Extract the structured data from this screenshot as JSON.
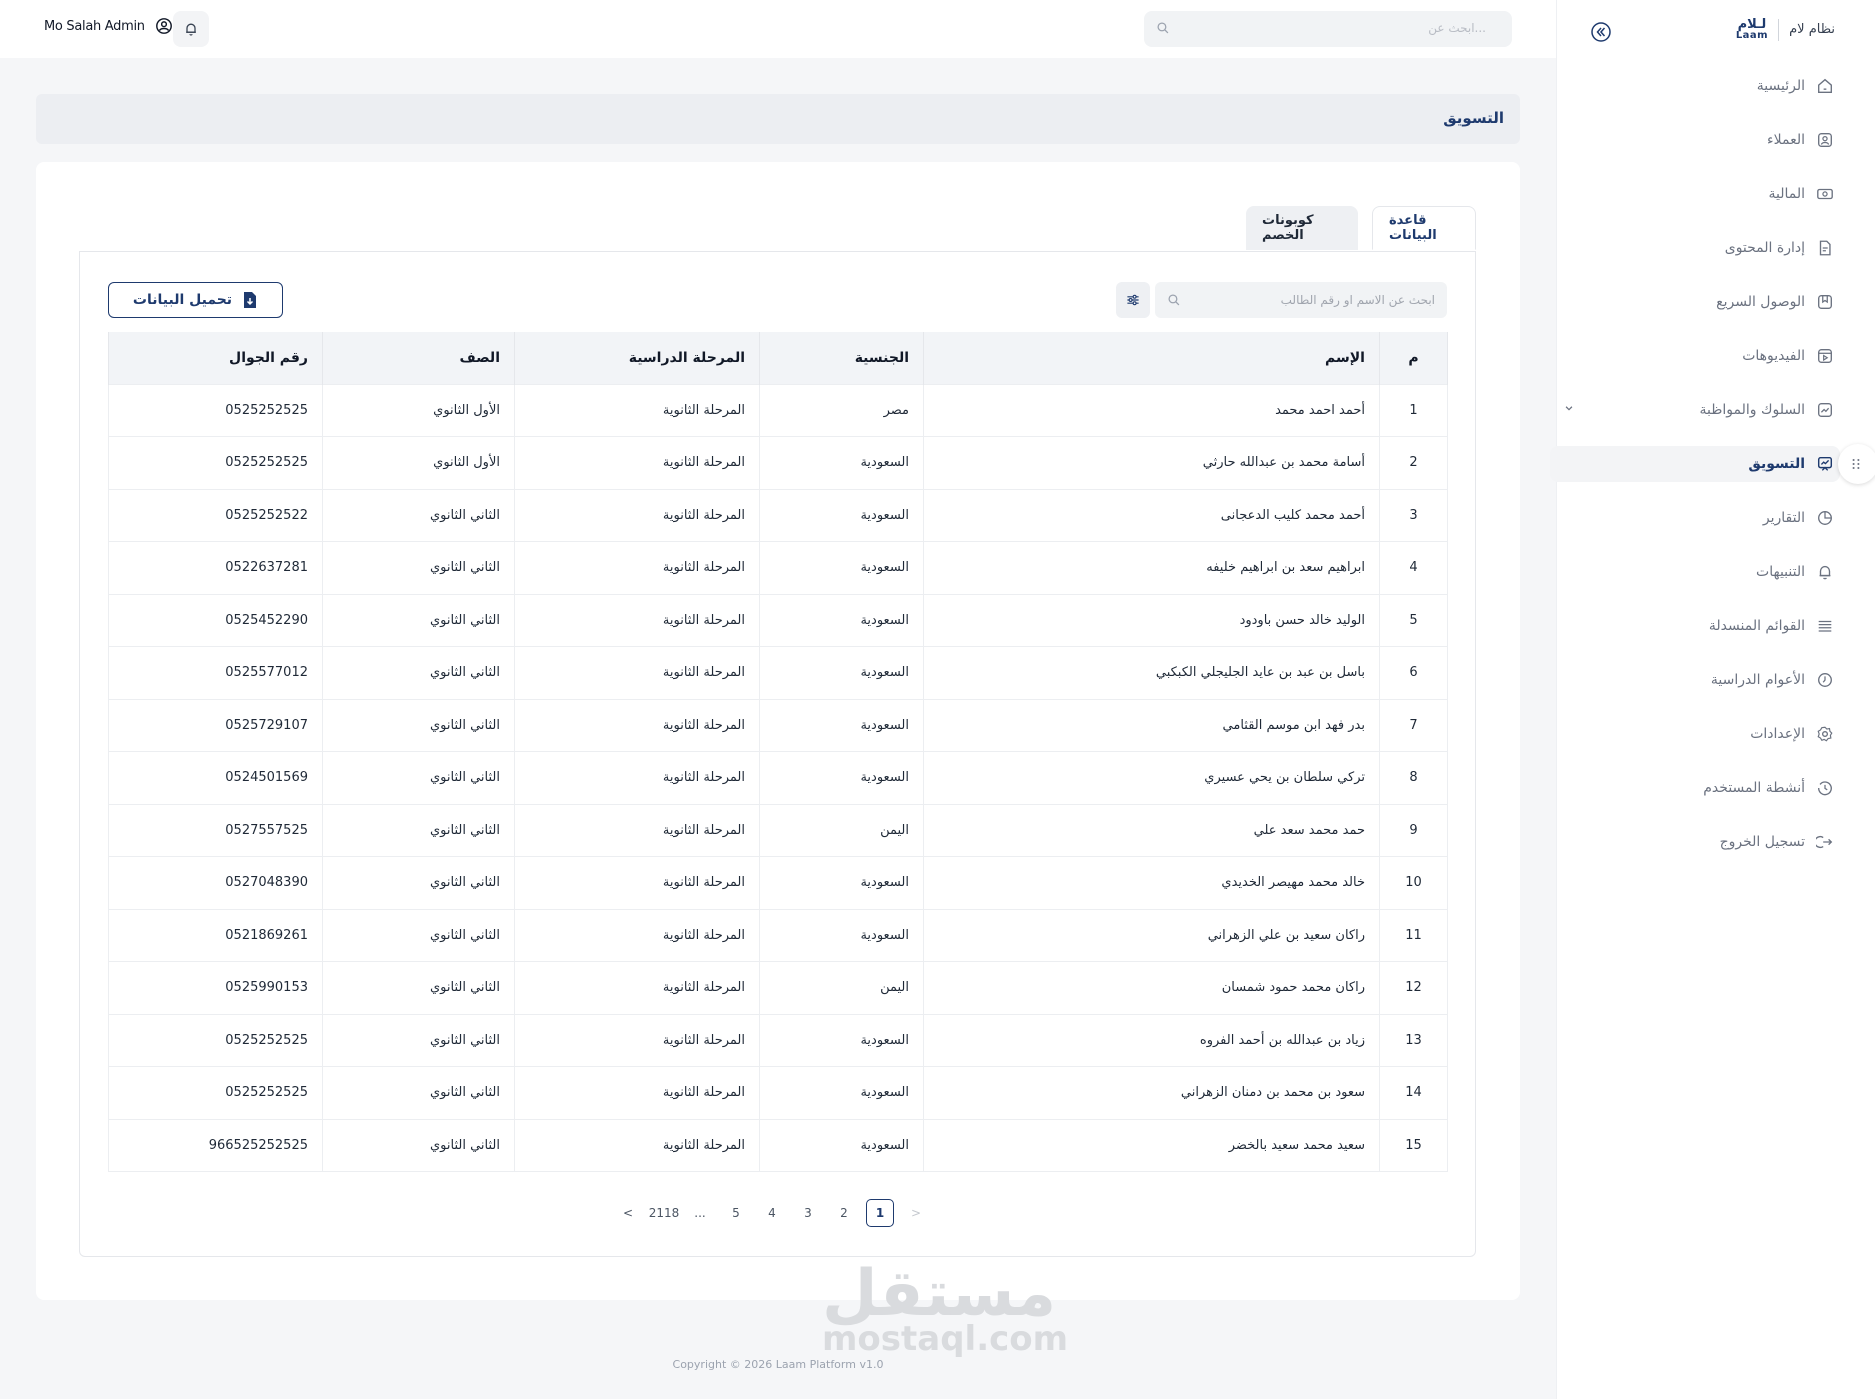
{
  "topbar": {
    "user_name": "Mo Salah Admin",
    "search_placeholder": "ابحث عن..."
  },
  "sidebar": {
    "system_name": "نظام لام",
    "logo_ar": "لـلام",
    "logo_en": "Laam",
    "items": [
      {
        "label": "الرئيسية",
        "icon": "home-icon"
      },
      {
        "label": "العملاء",
        "icon": "user-badge-icon"
      },
      {
        "label": "المالية",
        "icon": "money-icon"
      },
      {
        "label": "إدارة المحتوى",
        "icon": "document-icon"
      },
      {
        "label": "الوصول السريع",
        "icon": "bookmark-icon"
      },
      {
        "label": "الفيديوهات",
        "icon": "video-icon"
      },
      {
        "label": "السلوك والمواظبة",
        "icon": "chart-line-icon"
      },
      {
        "label": "التسويق",
        "icon": "presentation-icon"
      },
      {
        "label": "التقارير",
        "icon": "report-icon"
      },
      {
        "label": "التنبيهات",
        "icon": "bell-icon"
      },
      {
        "label": "القوائم المنسدلة",
        "icon": "list-icon"
      },
      {
        "label": "الأعوام الدراسية",
        "icon": "clock-icon"
      },
      {
        "label": "الإعدادات",
        "icon": "gear-icon"
      },
      {
        "label": "أنشطة المستخدم",
        "icon": "history-icon"
      },
      {
        "label": "تسجيل الخروج",
        "icon": "logout-icon"
      }
    ],
    "active_item": "التسويق"
  },
  "page": {
    "title": "التسويق",
    "tabs": [
      {
        "label": "قاعدة البيانات",
        "active": true
      },
      {
        "label": "كوبونات الخصم",
        "active": false
      }
    ],
    "search_placeholder": "ابحث عن الاسم او رقم الطالب",
    "download_label": "تحميل البيانات"
  },
  "table": {
    "headers": {
      "idx": "م",
      "name": "الإسم",
      "nationality": "الجنسية",
      "stage": "المرحلة الدراسية",
      "grade": "الصف",
      "phone": "رقم الجوال"
    },
    "rows": [
      {
        "idx": "1",
        "name": "أحمد احمد محمد",
        "nationality": "مصر",
        "stage": "المرحلة الثانوية",
        "grade": "الأول الثانوي",
        "phone": "0525252525"
      },
      {
        "idx": "2",
        "name": "أسامة محمد بن عبدالله حارثي",
        "nationality": "السعودية",
        "stage": "المرحلة الثانوية",
        "grade": "الأول الثانوي",
        "phone": "0525252525"
      },
      {
        "idx": "3",
        "name": "أحمد محمد كليب الدعجانى",
        "nationality": "السعودية",
        "stage": "المرحلة الثانوية",
        "grade": "الثاني الثانوي",
        "phone": "0525252522"
      },
      {
        "idx": "4",
        "name": "ابراهيم سعد بن ابراهيم خليفه",
        "nationality": "السعودية",
        "stage": "المرحلة الثانوية",
        "grade": "الثاني الثانوي",
        "phone": "0522637281"
      },
      {
        "idx": "5",
        "name": "الوليد خالد حسن باودود",
        "nationality": "السعودية",
        "stage": "المرحلة الثانوية",
        "grade": "الثاني الثانوي",
        "phone": "0525452290"
      },
      {
        "idx": "6",
        "name": "باسل بن عبد بن عايد الجليجلي الكبكبي",
        "nationality": "السعودية",
        "stage": "المرحلة الثانوية",
        "grade": "الثاني الثانوي",
        "phone": "0525577012"
      },
      {
        "idx": "7",
        "name": "بدر فهد ابن موسم القثامي",
        "nationality": "السعودية",
        "stage": "المرحلة الثانوية",
        "grade": "الثاني الثانوي",
        "phone": "0525729107"
      },
      {
        "idx": "8",
        "name": "تركي سلطان بن يحي عسيري",
        "nationality": "السعودية",
        "stage": "المرحلة الثانوية",
        "grade": "الثاني الثانوي",
        "phone": "0524501569"
      },
      {
        "idx": "9",
        "name": "حمد محمد سعد علي",
        "nationality": "اليمن",
        "stage": "المرحلة الثانوية",
        "grade": "الثاني الثانوي",
        "phone": "0527557525"
      },
      {
        "idx": "10",
        "name": "خالد محمد مهيصر الخديدي",
        "nationality": "السعودية",
        "stage": "المرحلة الثانوية",
        "grade": "الثاني الثانوي",
        "phone": "0527048390"
      },
      {
        "idx": "11",
        "name": "راكان سعيد بن علي الزهراني",
        "nationality": "السعودية",
        "stage": "المرحلة الثانوية",
        "grade": "الثاني الثانوي",
        "phone": "0521869261"
      },
      {
        "idx": "12",
        "name": "راكان محمد حمود شمسان",
        "nationality": "اليمن",
        "stage": "المرحلة الثانوية",
        "grade": "الثاني الثانوي",
        "phone": "0525990153"
      },
      {
        "idx": "13",
        "name": "زياد بن عبدالله بن أحمد الفروه",
        "nationality": "السعودية",
        "stage": "المرحلة الثانوية",
        "grade": "الثاني الثانوي",
        "phone": "0525252525"
      },
      {
        "idx": "14",
        "name": "سعود بن محمد بن دمنان الزهراني",
        "nationality": "السعودية",
        "stage": "المرحلة الثانوية",
        "grade": "الثاني الثانوي",
        "phone": "0525252525"
      },
      {
        "idx": "15",
        "name": "سعيد محمد سعيد بالخضر",
        "nationality": "السعودية",
        "stage": "المرحلة الثانوية",
        "grade": "الثاني الثانوي",
        "phone": "966525252525"
      }
    ]
  },
  "pagination": {
    "prev": "<",
    "pages": [
      "2118",
      "...",
      "5",
      "4",
      "3",
      "2",
      "1"
    ],
    "current": "1",
    "next": ">"
  },
  "footer": {
    "copyright": "Copyright © 2026 Laam Platform v1.0"
  },
  "watermark": {
    "ar": "مستقل",
    "en": "mostaql.com"
  },
  "colors": {
    "brand": "#1e3a6e",
    "muted": "#6b7280",
    "header_bg": "#eceef2"
  }
}
